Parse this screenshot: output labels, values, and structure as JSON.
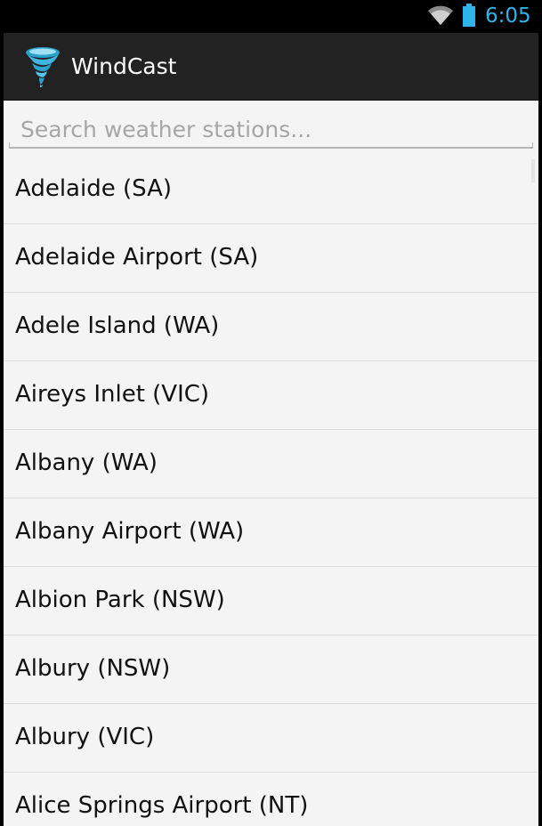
{
  "status_bar": {
    "time": "6:05",
    "wifi_icon": "wifi-icon",
    "battery_icon": "battery-icon",
    "accent_color": "#2fb4e9"
  },
  "action_bar": {
    "app_icon": "tornado-icon",
    "title": "WindCast",
    "background": "#222222"
  },
  "search": {
    "placeholder": "Search weather stations...",
    "value": ""
  },
  "stations": [
    {
      "label": "Adelaide (SA)"
    },
    {
      "label": "Adelaide Airport (SA)"
    },
    {
      "label": "Adele Island (WA)"
    },
    {
      "label": "Aireys Inlet (VIC)"
    },
    {
      "label": "Albany (WA)"
    },
    {
      "label": "Albany Airport (WA)"
    },
    {
      "label": "Albion Park (NSW)"
    },
    {
      "label": "Albury (NSW)"
    },
    {
      "label": "Albury (VIC)"
    },
    {
      "label": "Alice Springs Airport (NT)"
    }
  ]
}
